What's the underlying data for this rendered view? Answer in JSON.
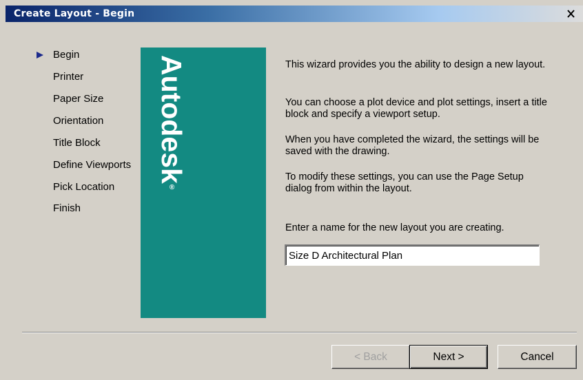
{
  "window": {
    "title": "Create Layout - Begin",
    "close_symbol": "×"
  },
  "steps": [
    {
      "label": "Begin",
      "current": true
    },
    {
      "label": "Printer",
      "current": false
    },
    {
      "label": "Paper Size",
      "current": false
    },
    {
      "label": "Orientation",
      "current": false
    },
    {
      "label": "Title Block",
      "current": false
    },
    {
      "label": "Define Viewports",
      "current": false
    },
    {
      "label": "Pick Location",
      "current": false
    },
    {
      "label": "Finish",
      "current": false
    }
  ],
  "brand": {
    "word": "Autodesk",
    "mark": "®",
    "panel_color": "#138a82"
  },
  "description": {
    "p1": "This wizard provides you the ability to design a new layout.",
    "p2": "You can choose a plot device and plot settings, insert a title block and specify a viewport setup.",
    "p3": "When you have completed the wizard, the settings will be saved with the drawing.",
    "p4": "To modify these settings, you can use the Page Setup dialog from within the layout."
  },
  "name_field": {
    "prompt": "Enter a name for the new layout you are creating.",
    "value": "Size D Architectural Plan"
  },
  "buttons": {
    "back": "< Back",
    "next": "Next >",
    "cancel": "Cancel"
  },
  "colors": {
    "title_bar_start": "#0a246a",
    "dialog_face": "#d4d0c8",
    "current_step_arrow": "#1c2a8c"
  },
  "icons": {
    "close": "close-icon",
    "current_step": "arrow-right-icon"
  }
}
